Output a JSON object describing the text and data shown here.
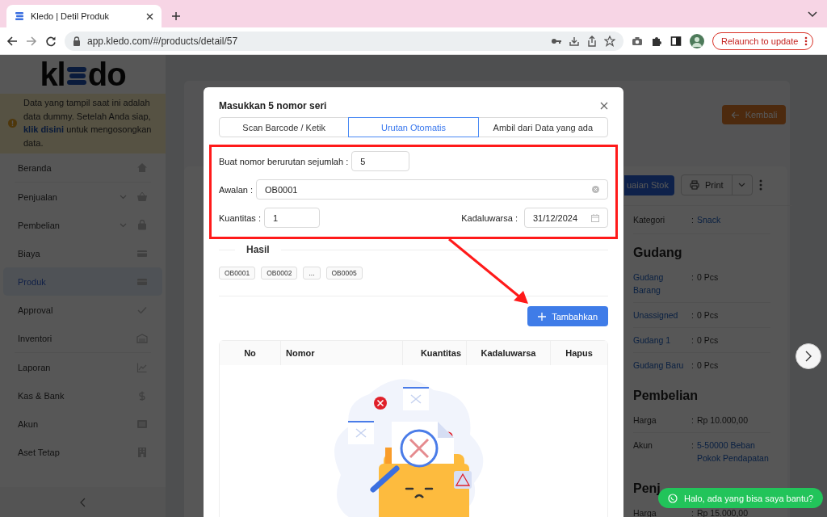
{
  "browser": {
    "tab_title": "Kledo | Detil Produk",
    "url": "app.kledo.com/#/products/detail/57",
    "relaunch": "Relaunch to update"
  },
  "sidebar": {
    "logo": [
      "kl",
      "do"
    ],
    "notice": {
      "before": "Data yang tampil saat ini adalah data dummy. Setelah Anda siap, ",
      "link": "klik disini",
      "after": " untuk mengosongkan data."
    },
    "groups": [
      [
        {
          "label": "Beranda",
          "selected": false,
          "expandable": false
        }
      ],
      [
        {
          "label": "Penjualan",
          "selected": false,
          "expandable": true
        },
        {
          "label": "Pembelian",
          "selected": false,
          "expandable": true
        },
        {
          "label": "Biaya",
          "selected": false,
          "expandable": false
        },
        {
          "label": "Produk",
          "selected": true,
          "expandable": false
        },
        {
          "label": "Approval",
          "selected": false,
          "expandable": false
        },
        {
          "label": "Inventori",
          "selected": false,
          "expandable": false
        }
      ],
      [
        {
          "label": "Laporan",
          "selected": false,
          "expandable": false
        },
        {
          "label": "Kas & Bank",
          "selected": false,
          "expandable": false
        },
        {
          "label": "Akun",
          "selected": false,
          "expandable": false
        },
        {
          "label": "Aset Tetap",
          "selected": false,
          "expandable": false
        }
      ]
    ]
  },
  "page": {
    "back_button": "Kembali",
    "stock_button": "uaian Stok",
    "print_button": "Print",
    "sections": [
      {
        "rows": [
          {
            "label": "Kategori",
            "sep": ":",
            "value": "Snack",
            "label_link": false,
            "value_link": true
          }
        ]
      },
      {
        "heading": "Gudang",
        "rows": [
          {
            "label": "Gudang Barang",
            "sep": ":",
            "value": "0 Pcs",
            "label_link": true,
            "value_link": false
          },
          {
            "label": "Unassigned",
            "sep": ":",
            "value": "0 Pcs",
            "label_link": true,
            "value_link": false
          },
          {
            "label": "Gudang 1",
            "sep": ":",
            "value": "0 Pcs",
            "label_link": true,
            "value_link": false
          },
          {
            "label": "Gudang Baru",
            "sep": ":",
            "value": "0 Pcs",
            "label_link": true,
            "value_link": false
          }
        ]
      },
      {
        "heading": "Pembelian",
        "rows": [
          {
            "label": "Harga",
            "sep": ":",
            "value": "Rp 10.000,00",
            "label_link": false,
            "value_link": false
          },
          {
            "label": "Akun",
            "sep": ":",
            "value": "5-50000 Beban Pokok Pendapatan",
            "label_link": false,
            "value_link": true
          }
        ]
      },
      {
        "heading": "Penj",
        "rows": [
          {
            "label": "Harga",
            "sep": ":",
            "value": "Rp 15.000,00",
            "label_link": false,
            "value_link": false
          }
        ]
      }
    ],
    "chat": "Halo, ada yang bisa saya bantu?"
  },
  "modal": {
    "title": "Masukkan 5 nomor seri",
    "tabs": [
      {
        "label": "Scan Barcode / Ketik",
        "selected": false
      },
      {
        "label": "Urutan Otomatis",
        "selected": true
      },
      {
        "label": "Ambil dari Data yang ada",
        "selected": false
      }
    ],
    "count_label": "Buat nomor berurutan sejumlah :",
    "count_value": "5",
    "prefix_label": "Awalan :",
    "prefix_value": "OB0001",
    "qty_label": "Kuantitas :",
    "qty_value": "1",
    "expiry_label": "Kadaluwarsa :",
    "expiry_value": "31/12/2024",
    "result_label": "Hasil",
    "results": [
      "OB0001",
      "OB0002",
      "...",
      "OB0005"
    ],
    "add_button": "Tambahkan",
    "columns": [
      "No",
      "Nomor",
      "Kuantitas",
      "Kadaluwarsa",
      "Hapus"
    ]
  }
}
